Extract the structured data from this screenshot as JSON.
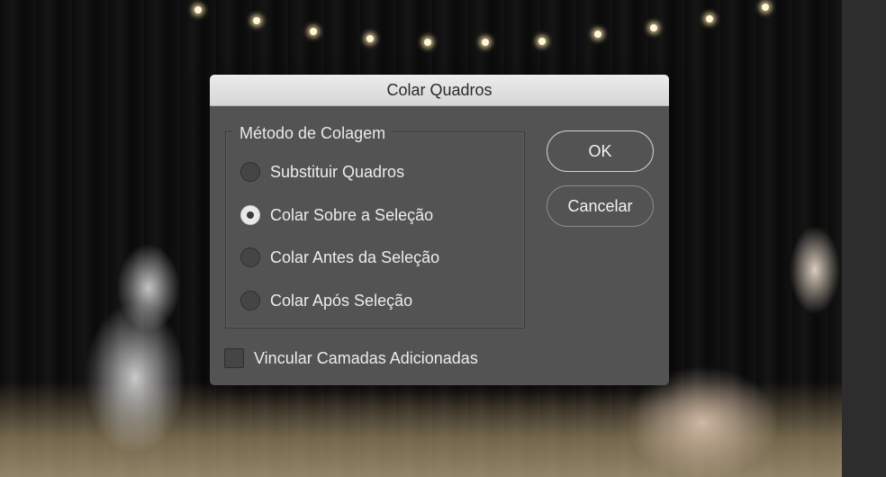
{
  "dialog": {
    "title": "Colar Quadros",
    "group_label": "Método de Colagem",
    "options": [
      {
        "label": "Substituir Quadros",
        "selected": false
      },
      {
        "label": "Colar Sobre a Seleção",
        "selected": true
      },
      {
        "label": "Colar Antes da Seleção",
        "selected": false
      },
      {
        "label": "Colar Após Seleção",
        "selected": false
      }
    ],
    "ok_label": "OK",
    "cancel_label": "Cancelar",
    "link_layers": {
      "label": "Vincular Camadas Adicionadas",
      "checked": false
    }
  }
}
